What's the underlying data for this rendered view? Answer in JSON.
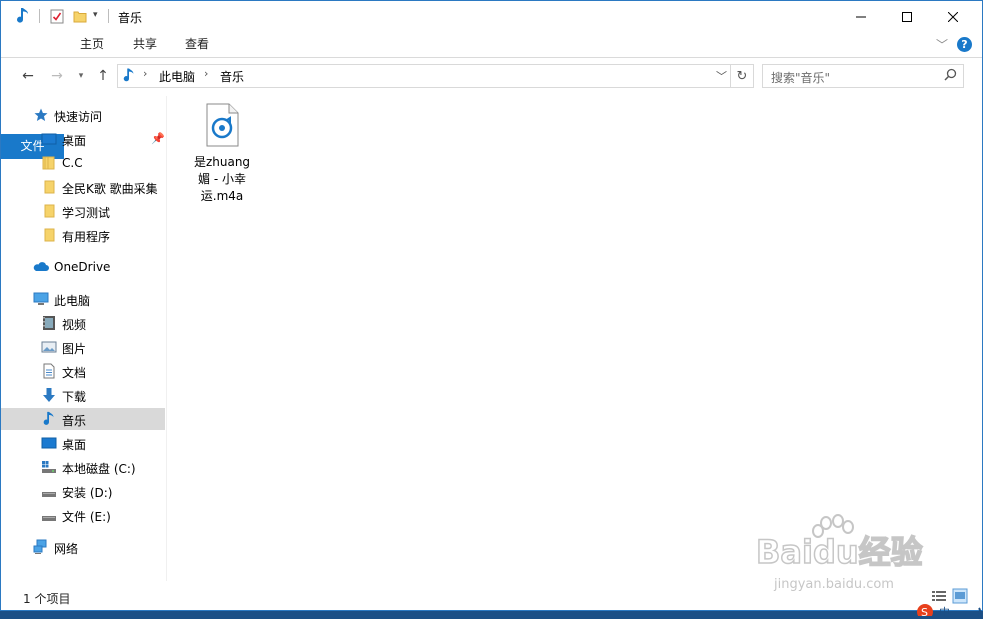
{
  "window": {
    "title": "音乐"
  },
  "ribbon": {
    "tabs": [
      "文件",
      "主页",
      "共享",
      "查看"
    ]
  },
  "address": {
    "crumbs": [
      "此电脑",
      "音乐"
    ]
  },
  "search": {
    "placeholder": "搜索\"音乐\""
  },
  "nav": {
    "quick_access": "快速访问",
    "quick_items": [
      "桌面",
      "C.C",
      "全民K歌 歌曲采集",
      "学习测试",
      "有用程序"
    ],
    "onedrive": "OneDrive",
    "this_pc": "此电脑",
    "pc_items": [
      "视频",
      "图片",
      "文档",
      "下载",
      "音乐",
      "桌面",
      "本地磁盘 (C:)",
      "安装 (D:)",
      "文件 (E:)"
    ],
    "network": "网络",
    "selected": "音乐"
  },
  "files": [
    {
      "name_lines": [
        "是zhuang",
        "媚 - 小幸",
        "运.m4a"
      ],
      "icon": "audio-file-icon"
    }
  ],
  "status": {
    "item_count": "1 个项目"
  },
  "watermark": {
    "brand": "Baidu经验",
    "url": "jingyan.baidu.com"
  },
  "colors": {
    "accent": "#1979ca",
    "desktop": "#1b4f86",
    "selected": "#d9d9d9"
  }
}
